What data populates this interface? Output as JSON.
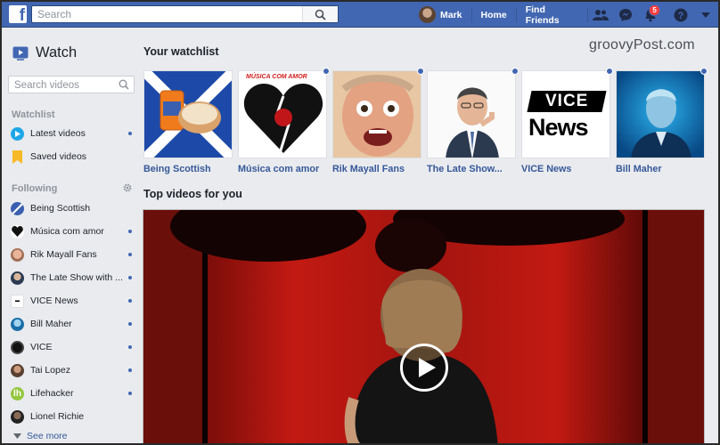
{
  "topbar": {
    "search_placeholder": "Search",
    "user_name": "Mark",
    "home_label": "Home",
    "find_friends_label": "Find Friends",
    "notification_count": "5"
  },
  "sidebar": {
    "title": "Watch",
    "search_placeholder": "Search videos",
    "watchlist_heading": "Watchlist",
    "watchlist_items": [
      {
        "label": "Latest videos",
        "icon": "play-circle-icon",
        "has_dot": true
      },
      {
        "label": "Saved videos",
        "icon": "bookmark-icon",
        "has_dot": false
      }
    ],
    "following_heading": "Following",
    "following_items": [
      {
        "label": "Being Scottish",
        "has_dot": false
      },
      {
        "label": "Música com amor",
        "has_dot": true
      },
      {
        "label": "Rik Mayall Fans",
        "has_dot": true
      },
      {
        "label": "The Late Show with ...",
        "has_dot": true
      },
      {
        "label": "VICE News",
        "has_dot": true
      },
      {
        "label": "Bill Maher",
        "has_dot": true
      },
      {
        "label": "VICE",
        "has_dot": true
      },
      {
        "label": "Tai Lopez",
        "has_dot": true
      },
      {
        "label": "Lifehacker",
        "has_dot": true
      },
      {
        "label": "Lionel Richie",
        "has_dot": false
      }
    ],
    "see_more": "See more"
  },
  "main": {
    "watchermark": "groovyPost.com",
    "watchlist_heading": "Your watchlist",
    "tiles": [
      {
        "label": "Being Scottish",
        "has_dot": false
      },
      {
        "label": "Música com amor",
        "has_dot": true,
        "overlay": "MÚSICA COM AMOR"
      },
      {
        "label": "Rik Mayall Fans",
        "has_dot": true
      },
      {
        "label": "The Late Show...",
        "has_dot": true
      },
      {
        "label": "VICE News",
        "has_dot": true,
        "logo_top": "VICE",
        "logo_bottom": "News"
      },
      {
        "label": "Bill Maher",
        "has_dot": true
      }
    ],
    "top_videos_heading": "Top videos for you"
  },
  "colors": {
    "brand": "#4267b2",
    "link": "#365899",
    "badge": "#fa3e3e"
  }
}
